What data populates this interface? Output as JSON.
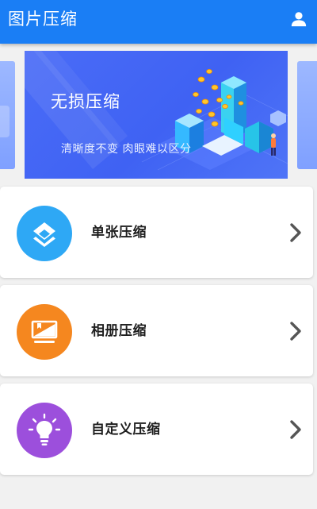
{
  "app_bar": {
    "title": "图片压缩",
    "profile_icon": "person-icon",
    "background": "#1a7ef5"
  },
  "banner": {
    "title": "无损压缩",
    "subtitle": "清晰度不变 肉眼难以区分",
    "background": "#4a6cf7"
  },
  "menu": {
    "items": [
      {
        "label": "单张压缩",
        "icon": "layers-icon",
        "color": "#2ea8f5"
      },
      {
        "label": "相册压缩",
        "icon": "gallery-icon",
        "color": "#f5871f"
      },
      {
        "label": "自定义压缩",
        "icon": "lightbulb-icon",
        "color": "#9c4fdc"
      }
    ],
    "chevron_icon": "chevron-right-icon"
  }
}
